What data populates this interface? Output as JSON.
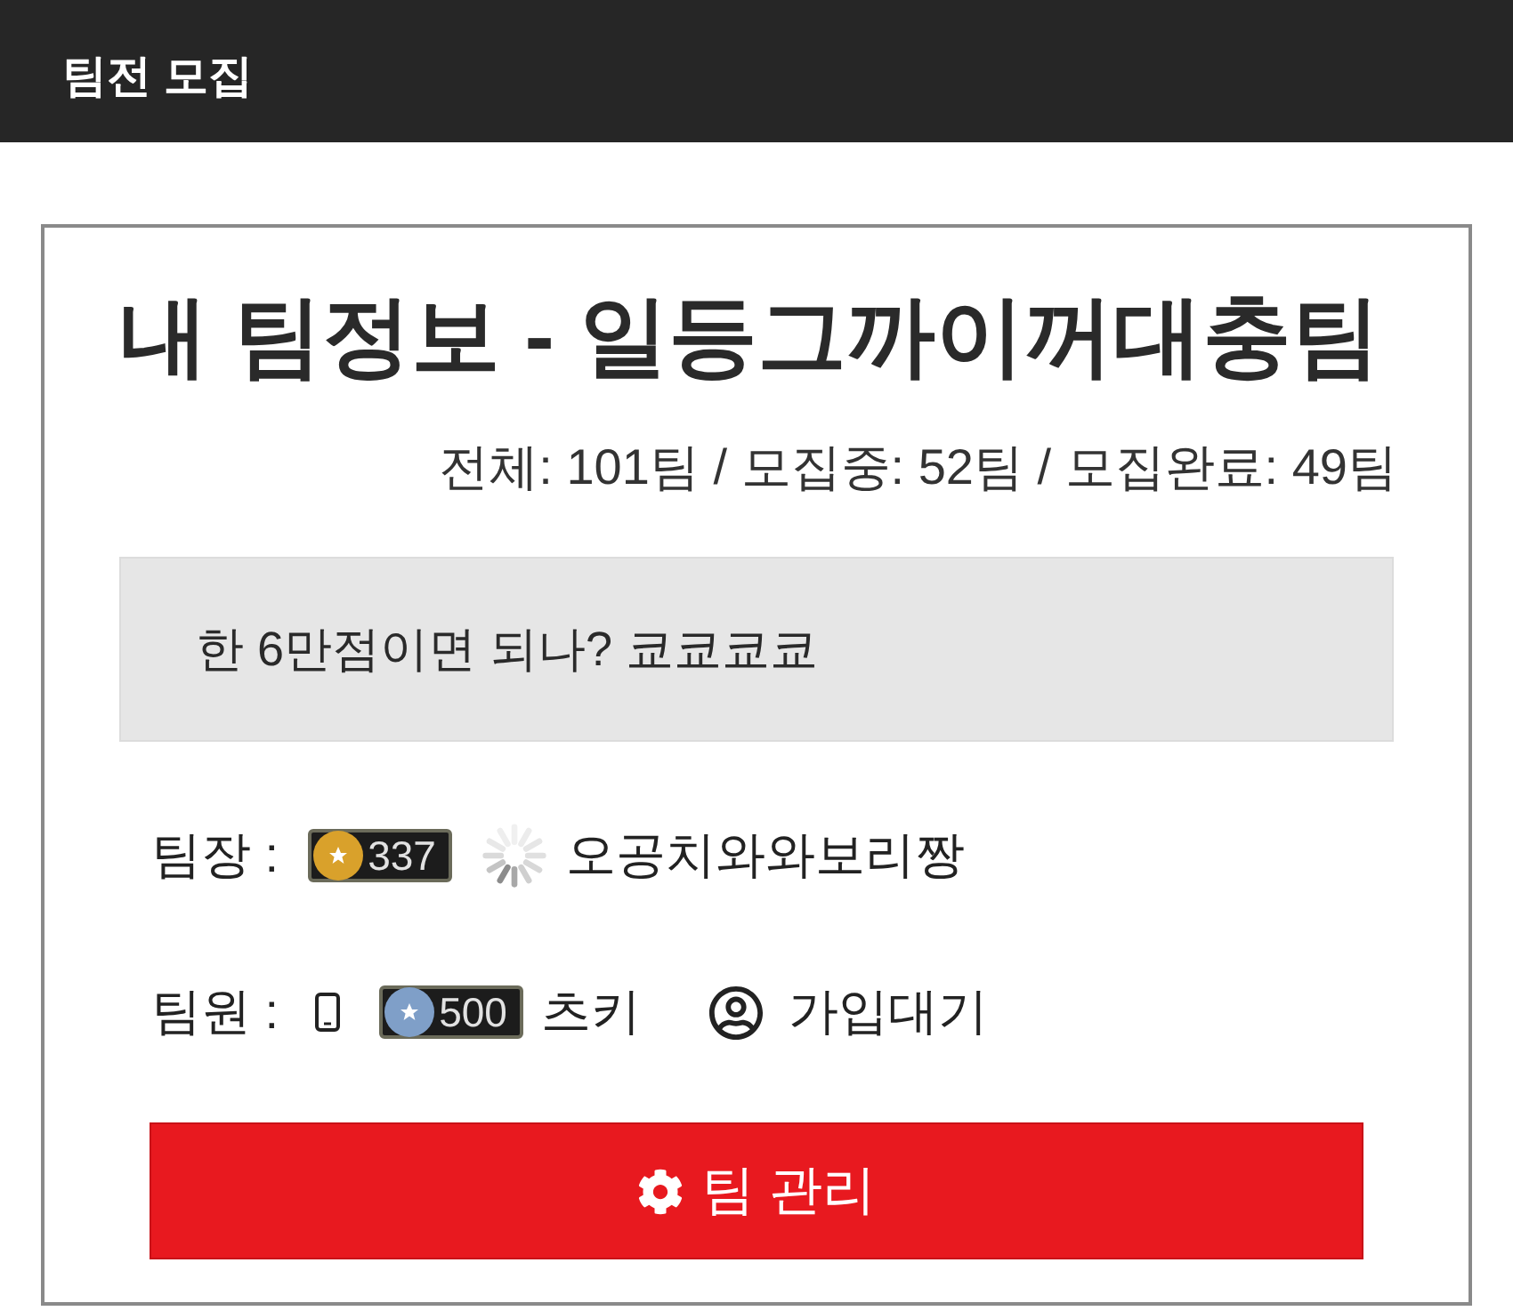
{
  "header": {
    "title": "팀전 모집"
  },
  "team": {
    "title": "내 팀정보 - 일등그까이꺼대충팀",
    "stats": "전체: 101팀 / 모집중: 52팀 / 모집완료: 49팀"
  },
  "message": "한 6만점이면 되나? 쿄쿄쿄쿄",
  "rows": [
    {
      "label": "팀장 :",
      "members": [
        {
          "kind": "player",
          "color": "#d9a12b",
          "level": "337",
          "loading": true,
          "name": "오공치와와보리짱"
        }
      ]
    },
    {
      "label": "팀원 :",
      "members": [
        {
          "kind": "player",
          "mobile": true,
          "color": "#7f9fc8",
          "level": "500",
          "name": "츠키"
        },
        {
          "kind": "pending",
          "name": "가입대기"
        }
      ]
    }
  ],
  "button": {
    "label": "팀 관리"
  }
}
